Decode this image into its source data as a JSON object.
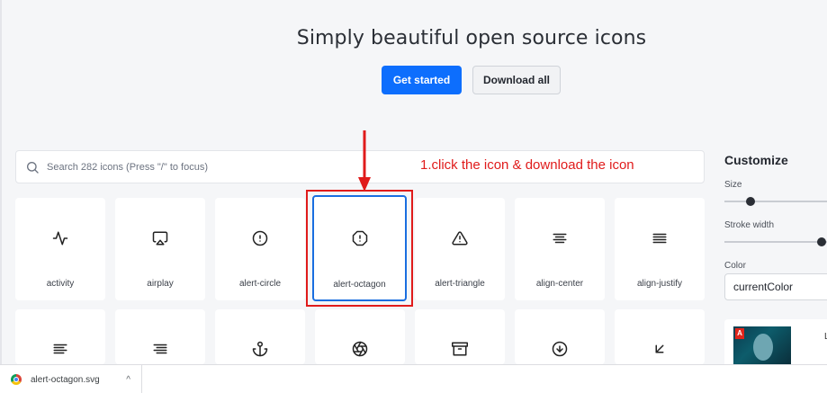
{
  "hero": {
    "title": "Simply beautiful open source icons",
    "get_started": "Get started",
    "download_all": "Download all"
  },
  "search": {
    "placeholder": "Search 282 icons (Press \"/\" to focus)"
  },
  "annotation": {
    "text": "1.click the icon & download the icon",
    "color": "#e01b1b"
  },
  "icons": {
    "row1": [
      {
        "label": "activity",
        "icon": "activity-icon"
      },
      {
        "label": "airplay",
        "icon": "airplay-icon"
      },
      {
        "label": "alert-circle",
        "icon": "alert-circle-icon"
      },
      {
        "label": "alert-octagon",
        "icon": "alert-octagon-icon",
        "selected": true
      },
      {
        "label": "alert-triangle",
        "icon": "alert-triangle-icon"
      },
      {
        "label": "align-center",
        "icon": "align-center-icon"
      },
      {
        "label": "align-justify",
        "icon": "align-justify-icon"
      }
    ],
    "row2": [
      {
        "icon": "align-left-icon"
      },
      {
        "icon": "align-right-icon"
      },
      {
        "icon": "anchor-icon"
      },
      {
        "icon": "aperture-icon"
      },
      {
        "icon": "archive-icon"
      },
      {
        "icon": "arrow-down-circle-icon"
      },
      {
        "icon": "arrow-down-left-icon"
      }
    ]
  },
  "customize": {
    "title": "Customize",
    "size_label": "Size",
    "stroke_label": "Stroke width",
    "color_label": "Color",
    "color_value": "currentColor"
  },
  "ad": {
    "logo": "A",
    "partial_text": "L"
  },
  "downloads": {
    "filename": "alert-octagon.svg",
    "chevron": "^"
  },
  "colors": {
    "primary": "#0d6efd",
    "selected_border": "#1a6ee0",
    "annotation_red": "#e01b1b"
  }
}
